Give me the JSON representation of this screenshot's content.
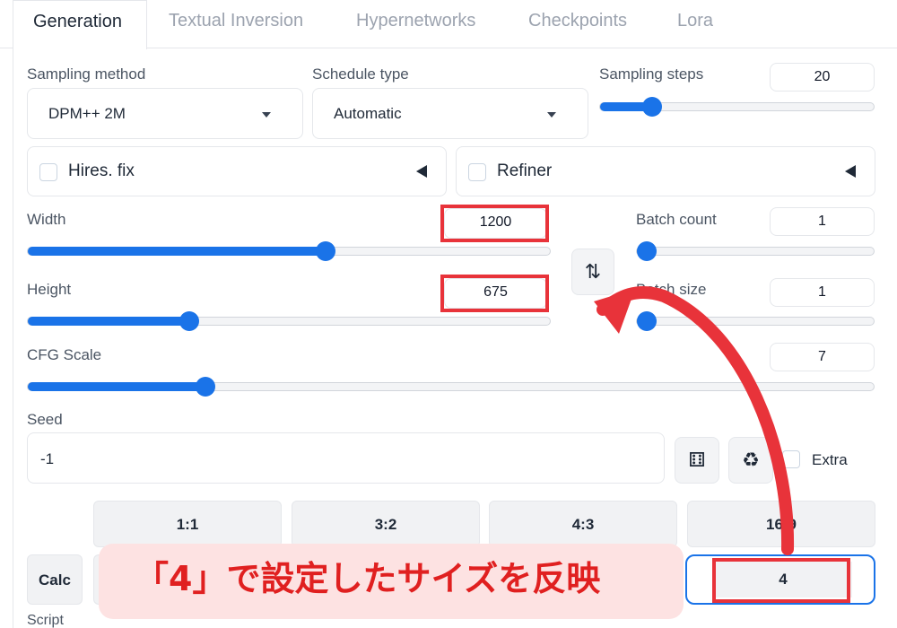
{
  "tabs": [
    "Generation",
    "Textual Inversion",
    "Hypernetworks",
    "Checkpoints",
    "Lora"
  ],
  "sampling": {
    "method_label": "Sampling method",
    "method_value": "DPM++ 2M",
    "schedule_label": "Schedule type",
    "schedule_value": "Automatic",
    "steps_label": "Sampling steps",
    "steps_value": "20",
    "steps_fraction": 0.19
  },
  "hires": {
    "label": "Hires. fix"
  },
  "refiner": {
    "label": "Refiner"
  },
  "width": {
    "label": "Width",
    "value": "1200",
    "fraction": 0.57
  },
  "height": {
    "label": "Height",
    "value": "675",
    "fraction": 0.31
  },
  "batch_count": {
    "label": "Batch count",
    "value": "1",
    "fraction": 0.0
  },
  "batch_size": {
    "label": "Batch size",
    "value": "1",
    "fraction": 0.0
  },
  "cfg": {
    "label": "CFG Scale",
    "value": "7",
    "fraction": 0.21
  },
  "seed": {
    "label": "Seed",
    "value": "-1",
    "extra_label": "Extra"
  },
  "ratios": [
    "1:1",
    "3:2",
    "4:3",
    "16:9"
  ],
  "calc_label": "Calc",
  "ratio_input_value": "4",
  "script_label": "Script",
  "annotation": "「4」で設定したサイズを反映",
  "colors": {
    "accent": "#1a73e8",
    "highlight_red": "#e8333a",
    "banner_bg": "#fde2e2"
  }
}
